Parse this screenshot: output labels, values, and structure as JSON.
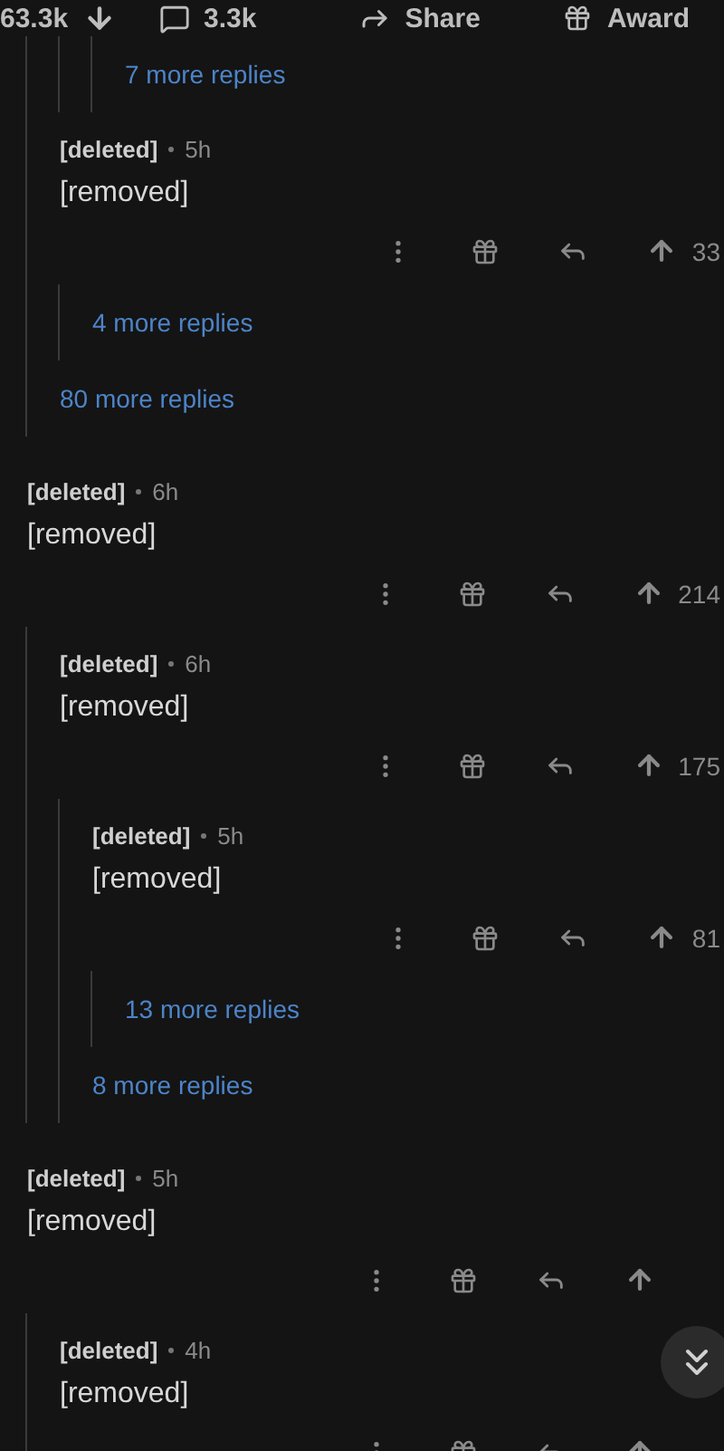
{
  "post_actions": {
    "score": "63.3k",
    "comments": "3.3k",
    "share": "Share",
    "award": "Award"
  },
  "thread": [
    {
      "kind": "thread",
      "children": [
        {
          "kind": "thread",
          "children": [
            {
              "kind": "thread",
              "children": [
                {
                  "kind": "more",
                  "label": "7 more replies"
                }
              ]
            }
          ]
        },
        {
          "kind": "comment",
          "author": "[deleted]",
          "time": "5h",
          "body": "[removed]",
          "score": "33",
          "children": [
            {
              "kind": "more",
              "label": "4 more replies"
            }
          ]
        },
        {
          "kind": "more",
          "label": "80 more replies"
        }
      ]
    },
    {
      "kind": "comment",
      "author": "[deleted]",
      "time": "6h",
      "body": "[removed]",
      "score": "214",
      "children": [
        {
          "kind": "comment",
          "author": "[deleted]",
          "time": "6h",
          "body": "[removed]",
          "score": "175",
          "children": [
            {
              "kind": "comment",
              "author": "[deleted]",
              "time": "5h",
              "body": "[removed]",
              "score": "81",
              "children": [
                {
                  "kind": "more",
                  "label": "13 more replies"
                }
              ]
            },
            {
              "kind": "more",
              "label": "8 more replies"
            }
          ]
        }
      ]
    },
    {
      "kind": "comment",
      "author": "[deleted]",
      "time": "5h",
      "body": "[removed]",
      "children": [
        {
          "kind": "comment",
          "author": "[deleted]",
          "time": "4h",
          "body": "[removed]"
        }
      ]
    }
  ]
}
